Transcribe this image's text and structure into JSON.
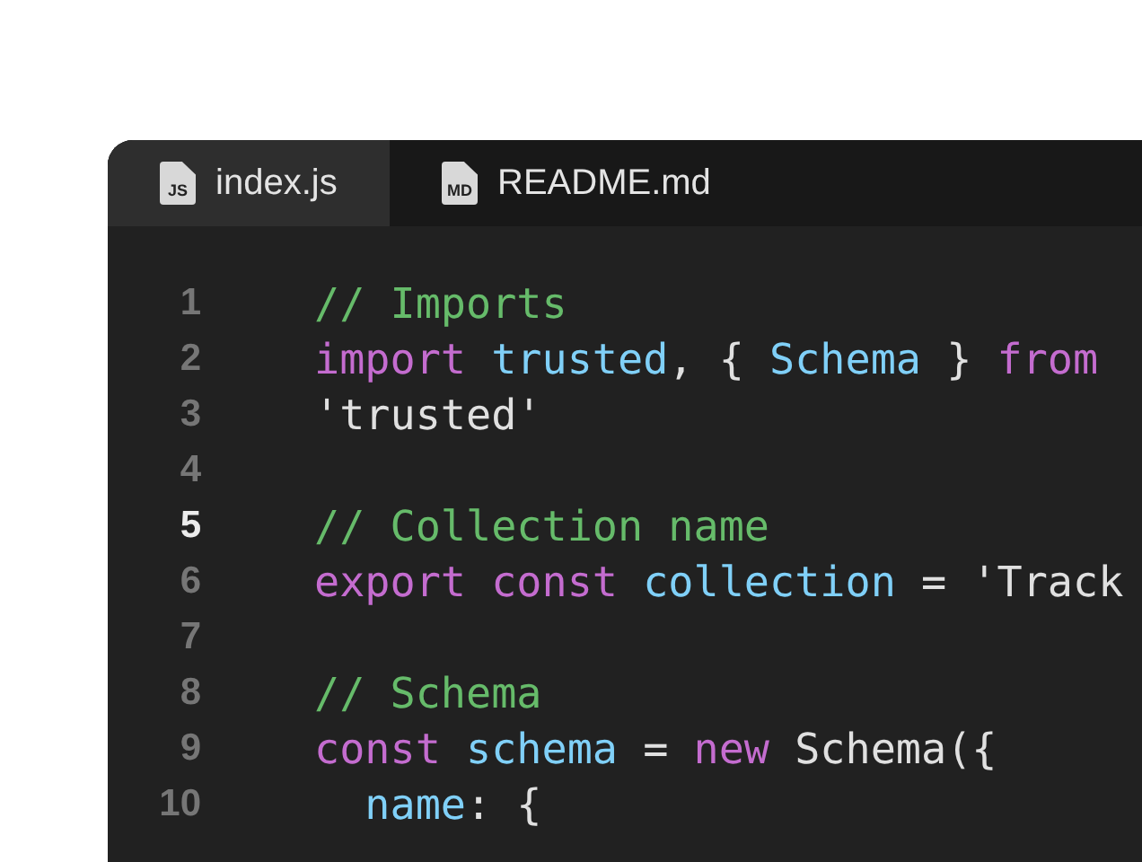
{
  "tabs": [
    {
      "label": "index.js",
      "icon_text": "JS",
      "selected": true
    },
    {
      "label": "README.md",
      "icon_text": "MD",
      "selected": false
    }
  ],
  "lines": [
    {
      "number": "1",
      "current": false,
      "tokens": [
        {
          "kind": "comment",
          "text": "// Imports"
        }
      ]
    },
    {
      "number": "2",
      "current": false,
      "tokens": [
        {
          "kind": "keyword",
          "text": "import "
        },
        {
          "kind": "identifier",
          "text": "trusted"
        },
        {
          "kind": "plain",
          "text": ", { "
        },
        {
          "kind": "identifier",
          "text": "Schema"
        },
        {
          "kind": "plain",
          "text": " } "
        },
        {
          "kind": "keyword",
          "text": "from"
        }
      ]
    },
    {
      "number": "3",
      "current": false,
      "tokens": [
        {
          "kind": "plain",
          "text": "'trusted'"
        }
      ]
    },
    {
      "number": "4",
      "current": false
    },
    {
      "number": "5",
      "current": true,
      "tokens": [
        {
          "kind": "comment",
          "text": "// Collection name"
        }
      ]
    },
    {
      "number": "6",
      "current": false,
      "tokens": [
        {
          "kind": "keyword",
          "text": "export const "
        },
        {
          "kind": "identifier",
          "text": "collection"
        },
        {
          "kind": "plain",
          "text": " = 'Track"
        }
      ]
    },
    {
      "number": "7",
      "current": false
    },
    {
      "number": "8",
      "current": false,
      "tokens": [
        {
          "kind": "comment",
          "text": "// Schema"
        }
      ]
    },
    {
      "number": "9",
      "current": false,
      "tokens": [
        {
          "kind": "keyword",
          "text": "const "
        },
        {
          "kind": "identifier",
          "text": "schema"
        },
        {
          "kind": "plain",
          "text": " = "
        },
        {
          "kind": "keyword",
          "text": "new"
        },
        {
          "kind": "plain",
          "text": " Schema({"
        }
      ]
    },
    {
      "number": "10",
      "current": false,
      "tokens": [
        {
          "kind": "identifier",
          "text": "  name"
        },
        {
          "kind": "plain",
          "text": ": {"
        }
      ]
    }
  ]
}
